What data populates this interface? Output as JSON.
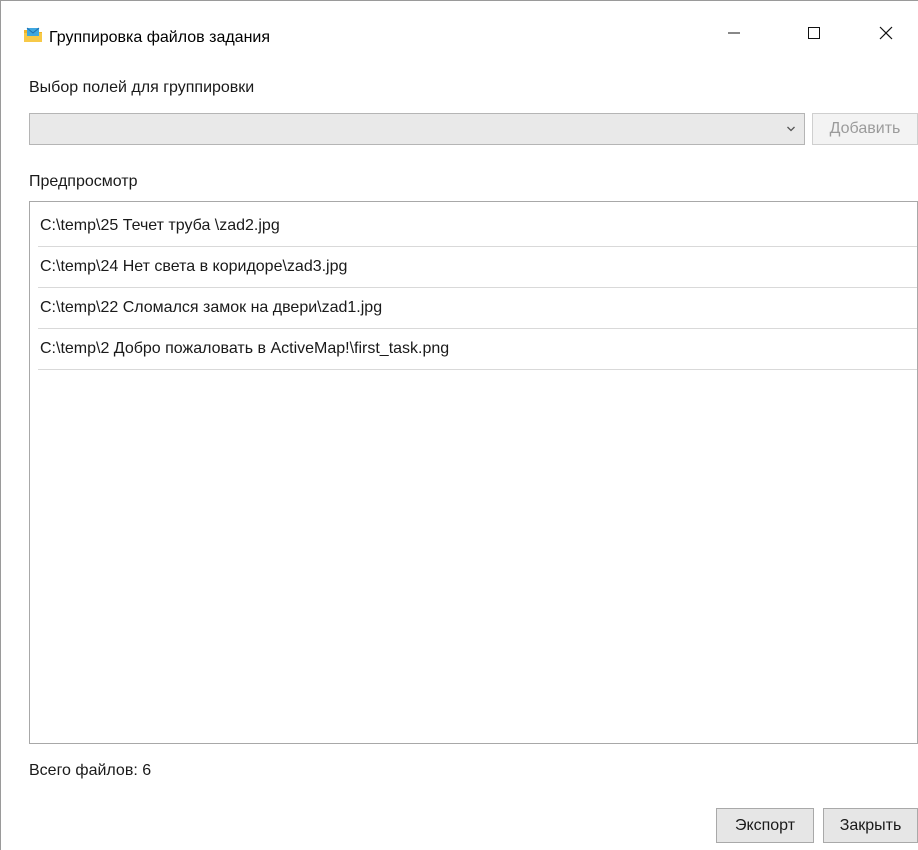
{
  "window": {
    "title": "Группировка файлов задания",
    "icon": "folder-envelope-icon",
    "controls": {
      "minimize": "minimize-icon",
      "maximize": "maximize-icon",
      "close": "close-icon"
    }
  },
  "grouping": {
    "label": "Выбор полей для группировки",
    "selected_value": "",
    "add_button_label": "Добавить"
  },
  "preview": {
    "label": "Предпросмотр",
    "files": [
      "C:\\temp\\25 Течет труба \\zad2.jpg",
      "C:\\temp\\24 Нет света в коридоре\\zad3.jpg",
      "C:\\temp\\22 Сломался замок на двери\\zad1.jpg",
      "C:\\temp\\2 Добро пожаловать в ActiveMap!\\first_task.png"
    ]
  },
  "footer": {
    "total_files": "Всего файлов: 6",
    "export_label": "Экспорт",
    "close_label": "Закрыть"
  },
  "colors": {
    "combo_background": "#e9e9e9",
    "button_background": "#e6e6e6",
    "disabled_text": "#9b9b9b"
  }
}
